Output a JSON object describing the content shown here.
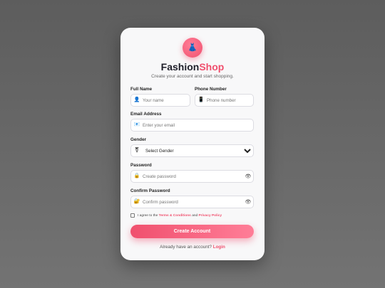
{
  "brand": {
    "name_primary": "Fashion",
    "name_accent": "Shop",
    "tagline": "Create your account and start shopping.",
    "logo_icon": "dress-icon"
  },
  "form": {
    "full_name": {
      "label": "Full Name",
      "placeholder": "Your name",
      "icon": "user-icon"
    },
    "phone": {
      "label": "Phone Number",
      "placeholder": "Phone number",
      "icon": "phone-icon"
    },
    "email": {
      "label": "Email Address",
      "placeholder": "Enter your email",
      "icon": "mail-icon"
    },
    "gender": {
      "label": "Gender",
      "selected": "Select Gender",
      "icon": "gender-icon"
    },
    "password": {
      "label": "Password",
      "placeholder": "Create password",
      "icon": "lock-icon"
    },
    "confirm_password": {
      "label": "Confirm Password",
      "placeholder": "Confirm password",
      "icon": "lock-key-icon"
    },
    "terms": {
      "prefix": "I agree to the",
      "terms_link": "Terms & Conditions",
      "and": "and",
      "privacy_link": "Privacy Policy"
    },
    "submit_label": "Create Account",
    "login_prompt": "Already have an account?",
    "login_link": "Login"
  },
  "colors": {
    "accent": "#f0506e",
    "background": "#666666",
    "card": "#f8f8f9"
  }
}
